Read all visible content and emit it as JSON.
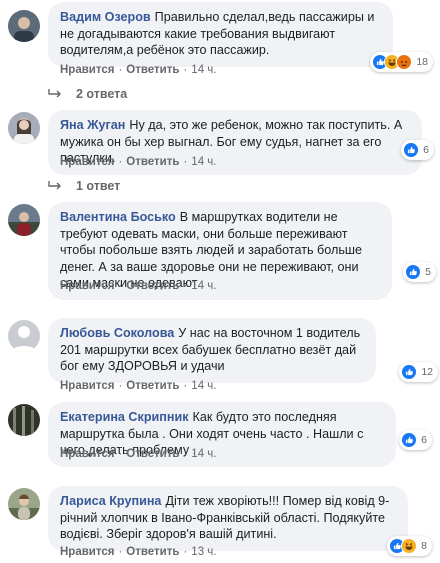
{
  "actions": {
    "like": "Нравится",
    "reply": "Ответить",
    "sep": "·"
  },
  "comments": [
    {
      "author": "Вадим Озеров",
      "text": "Правильно сделал,ведь пассажиры и не догадываются какие требования выдвигают водителям,а ребёнок это пассажир.",
      "time": "14 ч.",
      "reactions": [
        "like-icon",
        "haha-icon",
        "angry-icon"
      ],
      "count": "18",
      "replies": "2 ответа",
      "avatar_color": "#5b6b7a"
    },
    {
      "author": "Яна Жуган",
      "text": "Ну да, это же ребенок, можно так поступить. А мужика он бы хер выгнал. Бог ему судья, нагнет за его пастулки.",
      "time": "14 ч.",
      "reactions": [
        "like-icon"
      ],
      "count": "6",
      "replies": "1 ответ",
      "avatar_color": "#8a8fa0"
    },
    {
      "author": "Валентина Босько",
      "text": "В маршрутках водители не требуют одевать маски, они больше переживают чтобы побольше взять людей и заработать больше денег. А за ваше здоровье они не переживают, они сами маски не одевают",
      "time": "14 ч.",
      "reactions": [
        "like-icon"
      ],
      "count": "5",
      "replies": "",
      "avatar_color": "#6b7b8d"
    },
    {
      "author": "Любовь Соколова",
      "text": "У нас на восточном 1 водитель 201 маршрутки всех бабушек бесплатно везёт дай бог ему ЗДОРОВЬЯ и удачи",
      "time": "14 ч.",
      "reactions": [
        "like-icon"
      ],
      "count": "12",
      "replies": "",
      "avatar_color": "#c9ccd1"
    },
    {
      "author": "Екатерина Скрипник",
      "text": "Как будто это последняя маршрутка была . Они ходят очень часто . Нашли с чего делать проблему .",
      "time": "14 ч.",
      "reactions": [
        "like-icon"
      ],
      "count": "6",
      "replies": "",
      "avatar_color": "#4a4f45"
    },
    {
      "author": "Лариса Крупина",
      "text": "Діти теж хворіють!!! Помер від ковід 9-річний хлопчик в Івано-Франківській області. Подякуйте водієві. Зберіг здоров'я вашій дитині.",
      "time": "13 ч.",
      "reactions": [
        "like-icon",
        "haha-icon"
      ],
      "count": "8",
      "replies": "",
      "avatar_color": "#7d8a70"
    }
  ]
}
